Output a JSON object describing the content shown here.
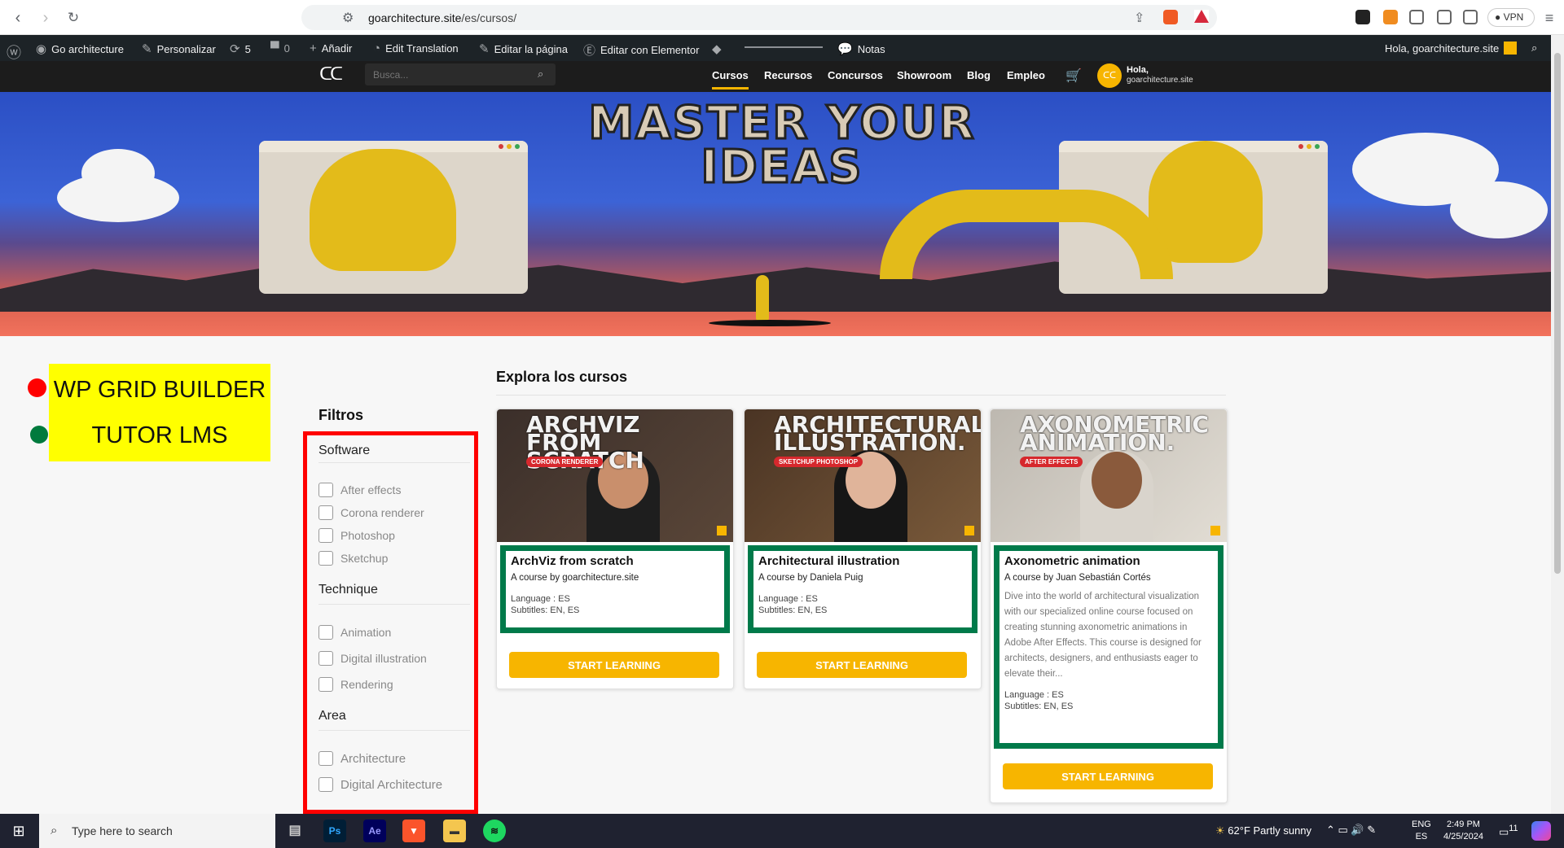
{
  "browser": {
    "url_host": "goarchitecture.site",
    "url_path": "/es/cursos/",
    "vpn_label": "VPN"
  },
  "wp_admin_bar": {
    "site_name": "Go architecture",
    "customize": "Personalizar",
    "updates_count": "5",
    "comments_count": "0",
    "add_new": "Añadir",
    "edit_translation": "Edit Translation",
    "edit_page": "Editar la página",
    "edit_elementor": "Editar con Elementor",
    "notes": "Notas",
    "greeting": "Hola, goarchitecture.site"
  },
  "site_header": {
    "search_placeholder": "Busca...",
    "nav": [
      "Cursos",
      "Recursos",
      "Concursos",
      "Showroom",
      "Blog",
      "Empleo"
    ],
    "user_hello": "Hola,",
    "user_name": "goarchitecture.site"
  },
  "hero": {
    "title_line1": "MASTER YOUR",
    "title_line2": "IDEAS"
  },
  "annotation": {
    "line1": "WP GRID BUILDER",
    "line2": "TUTOR LMS"
  },
  "filters": {
    "title": "Filtros",
    "groups": [
      {
        "title": "Software",
        "options": [
          "After effects",
          "Corona renderer",
          "Photoshop",
          "Sketchup"
        ]
      },
      {
        "title": "Technique",
        "options": [
          "Animation",
          "Digital illustration",
          "Rendering"
        ]
      },
      {
        "title": "Area",
        "options": [
          "Architecture",
          "Digital Architecture"
        ]
      }
    ]
  },
  "courses": {
    "title": "Explora los cursos",
    "items": [
      {
        "thumb_title": "ARCHVIZ FROM SCRATCH",
        "thumb_badge": "CORONA RENDERER",
        "name": "ArchViz from scratch",
        "author": "A course by goarchitecture.site",
        "description": "",
        "language": "Language : ES",
        "subtitles": "Subtitles: EN, ES",
        "cta": "START LEARNING"
      },
      {
        "thumb_title": "ARCHITECTURAL ILLUSTRATION.",
        "thumb_badge": "SKETCHUP PHOTOSHOP",
        "name": "Architectural illustration",
        "author": "A course by Daniela Puig",
        "description": "",
        "language": "Language : ES",
        "subtitles": "Subtitles: EN, ES",
        "cta": "START LEARNING"
      },
      {
        "thumb_title": "AXONOMETRIC ANIMATION.",
        "thumb_badge": "AFTER EFFECTS",
        "name": "Axonometric animation",
        "author": "A course by Juan Sebastián Cortés",
        "description": "Dive into the world of architectural visualization with our specialized online course focused on creating stunning axonometric animations in Adobe After Effects. This course is designed for architects, designers, and enthusiasts eager to elevate their...",
        "language": "Language : ES",
        "subtitles": "Subtitles: EN, ES",
        "cta": "START LEARNING"
      }
    ]
  },
  "taskbar": {
    "search_placeholder": "Type here to search",
    "apps": [
      "Ps",
      "Ae"
    ],
    "weather": "62°F  Partly sunny",
    "lang_top": "ENG",
    "lang_bottom": "ES",
    "time": "2:49 PM",
    "date": "4/25/2024",
    "notification_count": "11"
  },
  "colors": {
    "accent": "#f7b500",
    "filter_outline": "#ff0000",
    "course_info_border": "#007a4a",
    "annotation_bg": "#ffff00"
  }
}
